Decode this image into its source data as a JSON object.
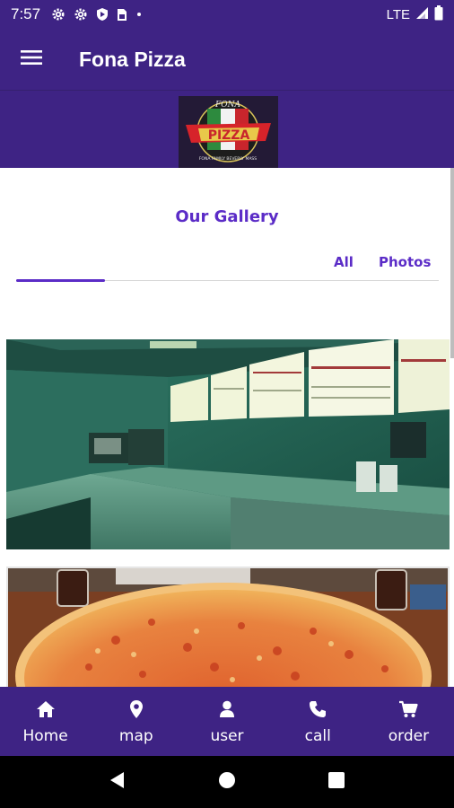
{
  "status_bar": {
    "time": "7:57",
    "network": "LTE",
    "icons": [
      "settings-icon",
      "settings-icon",
      "shield-icon",
      "sim-card-icon",
      "dot-icon",
      "signal-icon",
      "battery-icon"
    ]
  },
  "app_bar": {
    "title": "Fona Pizza",
    "menu_icon": "menu-icon",
    "color": "#3e2384"
  },
  "logo": {
    "text_top": "FONA",
    "text_main": "PIZZA",
    "text_bottom": "FONA FAMILY BEVERLY MASS"
  },
  "gallery": {
    "title": "Our Gallery",
    "tabs": [
      {
        "label": "All",
        "active": true
      },
      {
        "label": "Photos",
        "active": false
      }
    ],
    "accent": "#5b2cc7",
    "photos": [
      "pizzeria-counter-photo",
      "pizza-photo"
    ]
  },
  "bottom_nav": {
    "items": [
      {
        "label": "Home",
        "icon": "home-icon"
      },
      {
        "label": "map",
        "icon": "map-pin-icon"
      },
      {
        "label": "user",
        "icon": "user-icon"
      },
      {
        "label": "call",
        "icon": "phone-icon"
      },
      {
        "label": "order",
        "icon": "cart-icon"
      }
    ]
  },
  "system_nav": {
    "icons": [
      "back-icon",
      "home-circle-icon",
      "recents-icon"
    ]
  }
}
